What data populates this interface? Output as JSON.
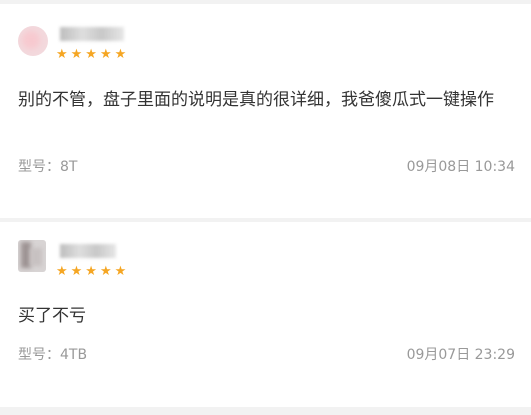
{
  "reviews": [
    {
      "stars": "★★★★★",
      "rating": 5,
      "text": "别的不管，盘子里面的说明是真的很详细，我爸傻瓜式一键操作",
      "model": "型号：8T",
      "date": "09月08日 10:34"
    },
    {
      "stars": "★★★★★",
      "rating": 5,
      "text": "买了不亏",
      "model": "型号：4TB",
      "date": "09月07日 23:29"
    }
  ],
  "colors": {
    "star": "#f5a623",
    "text": "#333333",
    "meta": "#999999",
    "background": "#f2f2f2",
    "card": "#ffffff"
  }
}
